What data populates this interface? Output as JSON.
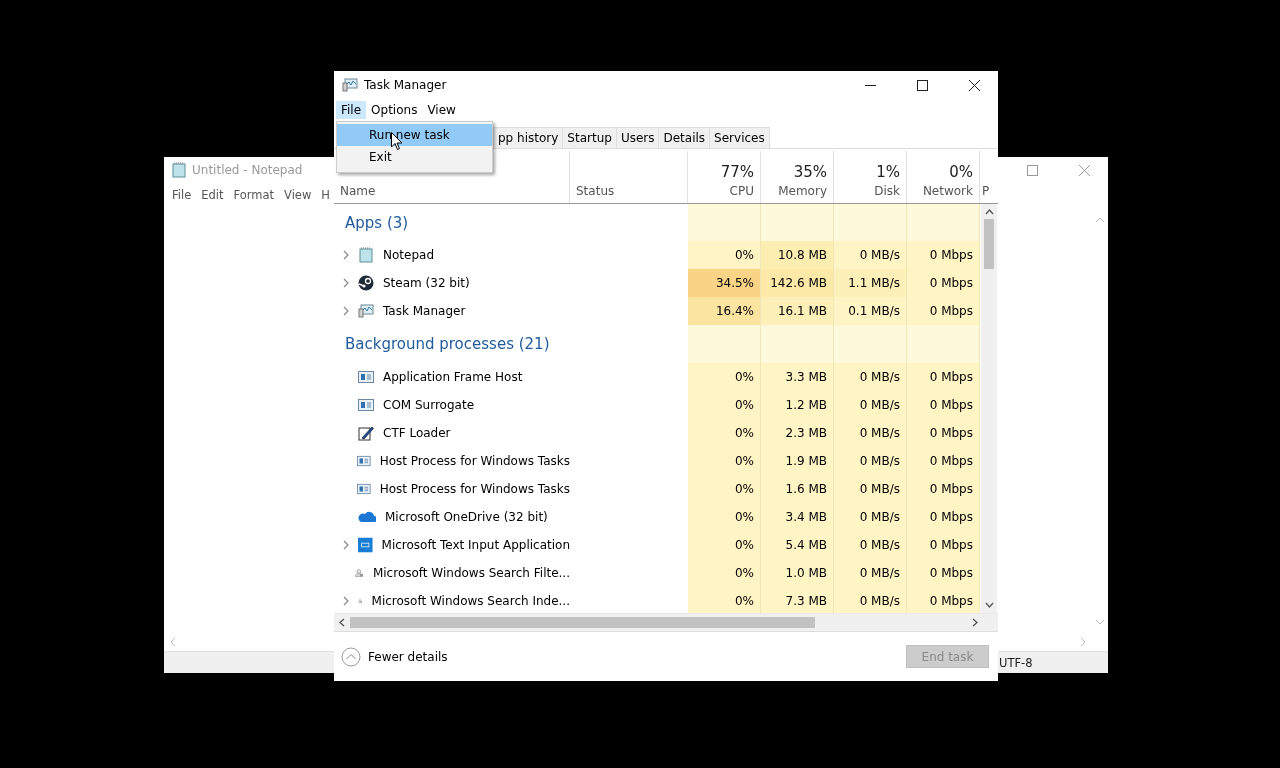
{
  "notepad": {
    "title": "Untitled - Notepad",
    "menu": [
      "File",
      "Edit",
      "Format",
      "View",
      "H"
    ],
    "status": "UTF-8"
  },
  "task_manager": {
    "title": "Task Manager",
    "menu": [
      {
        "label": "File",
        "selected": true
      },
      {
        "label": "Options",
        "selected": false
      },
      {
        "label": "View",
        "selected": false
      }
    ],
    "file_menu": [
      {
        "label": "Run new task",
        "selected": true
      },
      {
        "label": "Exit",
        "selected": false
      }
    ],
    "tabs": [
      {
        "label": "pp history",
        "selected": false
      },
      {
        "label": "Startup",
        "selected": false
      },
      {
        "label": "Users",
        "selected": false
      },
      {
        "label": "Details",
        "selected": false
      },
      {
        "label": "Services",
        "selected": false
      }
    ],
    "columns": [
      {
        "label": "Name"
      },
      {
        "label": "Status"
      },
      {
        "label": "CPU",
        "usage": "77%"
      },
      {
        "label": "Memory",
        "usage": "35%"
      },
      {
        "label": "Disk",
        "usage": "1%"
      },
      {
        "label": "Network",
        "usage": "0%"
      },
      {
        "label": "P"
      }
    ],
    "groups": [
      {
        "title": "Apps (3)",
        "rows": [
          {
            "name": "Notepad",
            "kind": "notepad",
            "expandable": true,
            "cells": [
              {
                "text": "0%",
                "color": "#fff4c4"
              },
              {
                "text": "10.8 MB",
                "color": "#fcedb0"
              },
              {
                "text": "0 MB/s",
                "color": "#fff4c4"
              },
              {
                "text": "0 Mbps",
                "color": "#fff4c4"
              }
            ]
          },
          {
            "name": "Steam (32 bit)",
            "kind": "steam",
            "expandable": true,
            "cells": [
              {
                "text": "34.5%",
                "color": "#f9d487"
              },
              {
                "text": "142.6 MB",
                "color": "#fce9a7"
              },
              {
                "text": "1.1 MB/s",
                "color": "#fdefb8"
              },
              {
                "text": "0 Mbps",
                "color": "#fff4c4"
              }
            ]
          },
          {
            "name": "Task Manager",
            "kind": "monitor",
            "expandable": true,
            "cells": [
              {
                "text": "16.4%",
                "color": "#fbe3a0"
              },
              {
                "text": "16.1 MB",
                "color": "#fdefb8"
              },
              {
                "text": "0.1 MB/s",
                "color": "#fff4c4"
              },
              {
                "text": "0 Mbps",
                "color": "#fff4c4"
              }
            ]
          }
        ]
      },
      {
        "title": "Background processes (21)",
        "rows": [
          {
            "name": "Application Frame Host",
            "kind": "window",
            "expandable": false,
            "cells": [
              {
                "text": "0%",
                "color": "#fff4c4"
              },
              {
                "text": "3.3 MB",
                "color": "#fff4c4"
              },
              {
                "text": "0 MB/s",
                "color": "#fff4c4"
              },
              {
                "text": "0 Mbps",
                "color": "#fff4c4"
              }
            ]
          },
          {
            "name": "COM Surrogate",
            "kind": "window",
            "expandable": false,
            "cells": [
              {
                "text": "0%",
                "color": "#fff4c4"
              },
              {
                "text": "1.2 MB",
                "color": "#fff4c4"
              },
              {
                "text": "0 MB/s",
                "color": "#fff4c4"
              },
              {
                "text": "0 Mbps",
                "color": "#fff4c4"
              }
            ]
          },
          {
            "name": "CTF Loader",
            "kind": "pen",
            "expandable": false,
            "cells": [
              {
                "text": "0%",
                "color": "#fff4c4"
              },
              {
                "text": "2.3 MB",
                "color": "#fff4c4"
              },
              {
                "text": "0 MB/s",
                "color": "#fff4c4"
              },
              {
                "text": "0 Mbps",
                "color": "#fff4c4"
              }
            ]
          },
          {
            "name": "Host Process for Windows Tasks",
            "kind": "window",
            "expandable": false,
            "cells": [
              {
                "text": "0%",
                "color": "#fff4c4"
              },
              {
                "text": "1.9 MB",
                "color": "#fff4c4"
              },
              {
                "text": "0 MB/s",
                "color": "#fff4c4"
              },
              {
                "text": "0 Mbps",
                "color": "#fff4c4"
              }
            ]
          },
          {
            "name": "Host Process for Windows Tasks",
            "kind": "window",
            "expandable": false,
            "cells": [
              {
                "text": "0%",
                "color": "#fff4c4"
              },
              {
                "text": "1.6 MB",
                "color": "#fff4c4"
              },
              {
                "text": "0 MB/s",
                "color": "#fff4c4"
              },
              {
                "text": "0 Mbps",
                "color": "#fff4c4"
              }
            ]
          },
          {
            "name": "Microsoft OneDrive (32 bit)",
            "kind": "cloud",
            "expandable": false,
            "cells": [
              {
                "text": "0%",
                "color": "#fff4c4"
              },
              {
                "text": "3.4 MB",
                "color": "#fff4c4"
              },
              {
                "text": "0 MB/s",
                "color": "#fff4c4"
              },
              {
                "text": "0 Mbps",
                "color": "#fff4c4"
              }
            ]
          },
          {
            "name": "Microsoft Text Input Application",
            "kind": "keyboard",
            "expandable": true,
            "cells": [
              {
                "text": "0%",
                "color": "#fff4c4"
              },
              {
                "text": "5.4 MB",
                "color": "#fff4c4"
              },
              {
                "text": "0 MB/s",
                "color": "#fff4c4"
              },
              {
                "text": "0 Mbps",
                "color": "#fff4c4"
              }
            ]
          },
          {
            "name": "Microsoft Windows Search Filte...",
            "kind": "search",
            "expandable": false,
            "cells": [
              {
                "text": "0%",
                "color": "#fff4c4"
              },
              {
                "text": "1.0 MB",
                "color": "#fff4c4"
              },
              {
                "text": "0 MB/s",
                "color": "#fff4c4"
              },
              {
                "text": "0 Mbps",
                "color": "#fff4c4"
              }
            ]
          },
          {
            "name": "Microsoft Windows Search Inde...",
            "kind": "search",
            "expandable": true,
            "cells": [
              {
                "text": "0%",
                "color": "#fff4c4"
              },
              {
                "text": "7.3 MB",
                "color": "#fff4c4"
              },
              {
                "text": "0 MB/s",
                "color": "#fff4c4"
              },
              {
                "text": "0 Mbps",
                "color": "#fff4c4"
              }
            ]
          }
        ]
      }
    ],
    "fewer_details": "Fewer details",
    "end_task": {
      "label": "End task",
      "disabled": true
    }
  }
}
